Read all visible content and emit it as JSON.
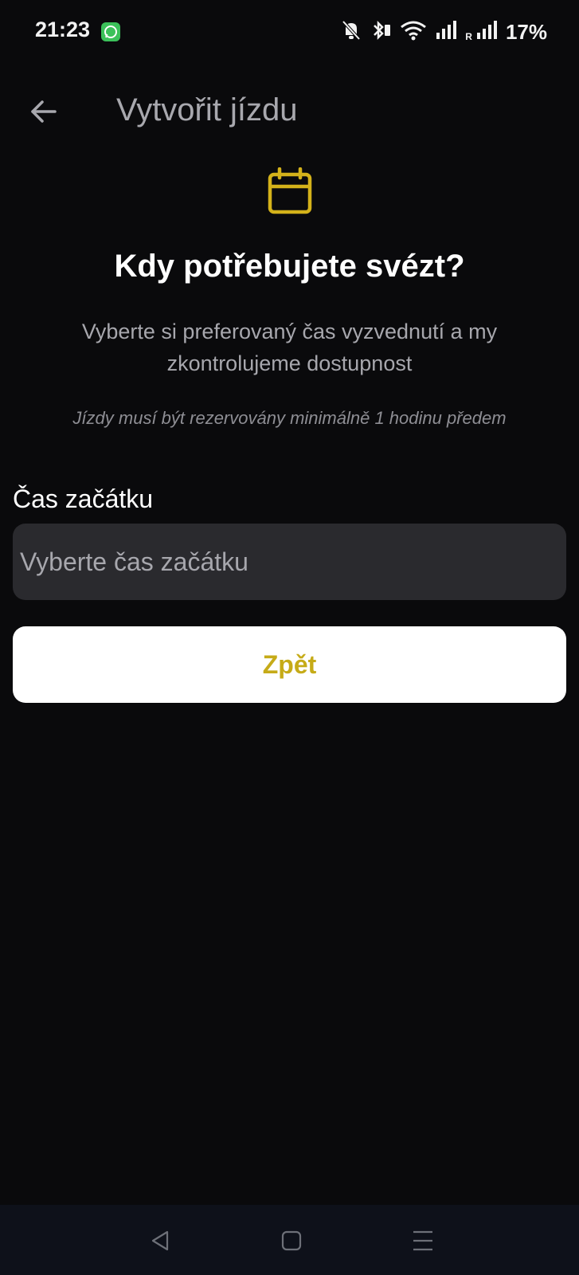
{
  "status_bar": {
    "time": "21:23",
    "notification_icons": [
      "whatsapp-icon"
    ],
    "system_icons": [
      "mute-icon",
      "bluetooth-icon",
      "wifi-icon",
      "signal-icon",
      "roaming-signal-icon"
    ],
    "roaming_label": "R",
    "battery": "17%"
  },
  "header": {
    "back_icon": "arrow-left-icon",
    "title": "Vytvořit jízdu"
  },
  "main": {
    "icon": "calendar-icon",
    "accent_color": "#d4b21a",
    "question": "Kdy potřebujete svézt?",
    "description": "Vyberte si preferovaný čas vyzvednutí a my zkontrolujeme dostupnost",
    "note": "Jízdy musí být rezervovány minimálně 1 hodinu předem",
    "field_label": "Čas začátku",
    "field_placeholder": "Vyberte čas začátku",
    "back_button_label": "Zpět"
  },
  "nav_bar": {
    "buttons": [
      "back-triangle-icon",
      "home-square-icon",
      "menu-lines-icon"
    ]
  }
}
